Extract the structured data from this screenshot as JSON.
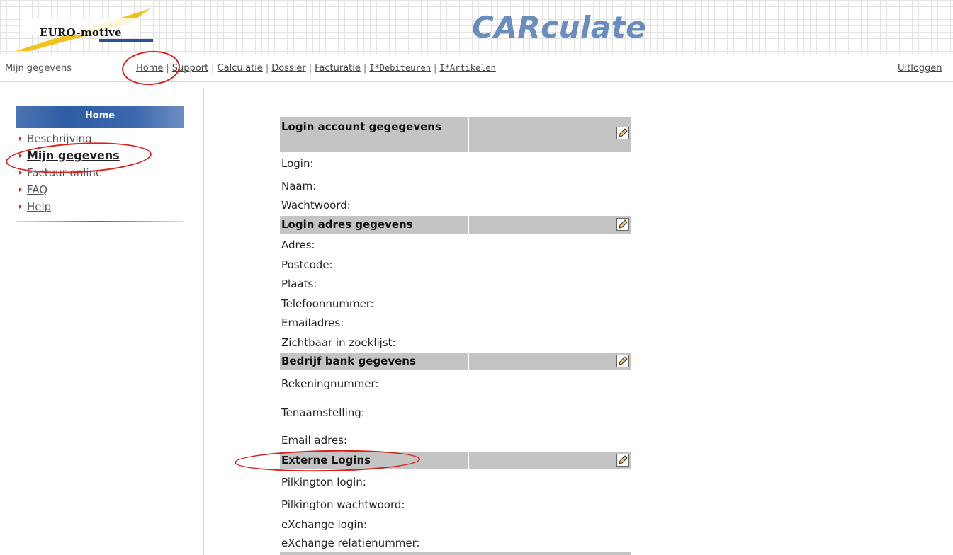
{
  "header": {
    "logo_text": "EURO-motive",
    "app_title": "CARculate"
  },
  "nav": {
    "current_page": "Mijn gegevens",
    "links": [
      "Home",
      "Support",
      "Calculatie",
      "Dossier",
      "Facturatie",
      "I*Debiteuren",
      "I*Artikelen"
    ],
    "logout": "Uitloggen"
  },
  "sidebar": {
    "heading": "Home",
    "items": [
      {
        "label": "Beschrijving"
      },
      {
        "label": "Mijn gegevens"
      },
      {
        "label": "Factuur online"
      },
      {
        "label": "FAQ"
      },
      {
        "label": "Help"
      }
    ]
  },
  "form": {
    "sections": [
      {
        "title": "Login account gegegevens",
        "fields": [
          "Login:",
          "Naam:",
          "Wachtwoord:"
        ]
      },
      {
        "title": "Login adres gegevens",
        "fields": [
          "Adres:",
          "Postcode:",
          "Plaats:",
          "Telefoonnummer:",
          "Emailadres:",
          "Zichtbaar in zoeklijst:"
        ]
      },
      {
        "title": "Bedrijf bank gegevens",
        "fields": [
          "Rekeningnummer:",
          "Tenaamstelling:",
          "Email adres:"
        ]
      },
      {
        "title": "Externe Logins",
        "fields": [
          "Pilkington login:",
          "Pilkington wachtwoord:",
          "eXchange login:",
          "eXchange relatienummer:"
        ]
      }
    ]
  },
  "colors": {
    "accent_blue": "#6b8dbd",
    "menu_blue": "#2f5da4",
    "section_grey": "#c4c4c4",
    "annotation_red": "#d8201c"
  }
}
